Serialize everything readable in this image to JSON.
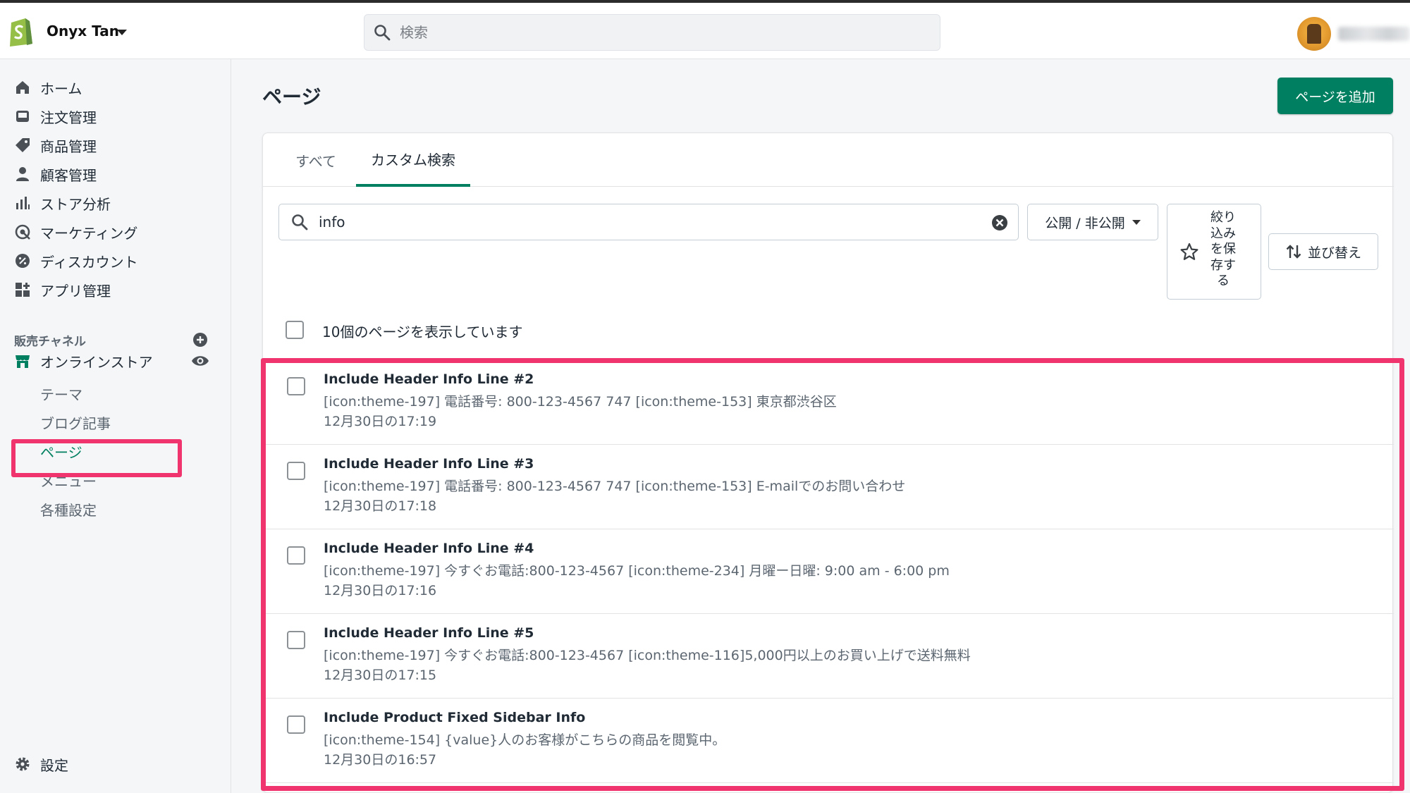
{
  "topbar": {
    "store_name": "Onyx Tan",
    "search_placeholder": "検索"
  },
  "sidebar": {
    "items": [
      {
        "label": "ホーム",
        "icon": "home-icon"
      },
      {
        "label": "注文管理",
        "icon": "inbox-icon"
      },
      {
        "label": "商品管理",
        "icon": "tag-icon"
      },
      {
        "label": "顧客管理",
        "icon": "person-icon"
      },
      {
        "label": "ストア分析",
        "icon": "bar-chart-icon"
      },
      {
        "label": "マーケティング",
        "icon": "target-icon"
      },
      {
        "label": "ディスカウント",
        "icon": "discount-icon"
      },
      {
        "label": "アプリ管理",
        "icon": "apps-icon"
      }
    ],
    "section_label": "販売チャネル",
    "online_store": "オンラインストア",
    "sub_items": [
      {
        "label": "テーマ",
        "active": false
      },
      {
        "label": "ブログ記事",
        "active": false
      },
      {
        "label": "ページ",
        "active": true
      },
      {
        "label": "メニュー",
        "active": false
      },
      {
        "label": "各種設定",
        "active": false
      }
    ],
    "settings": "設定"
  },
  "main": {
    "title": "ページ",
    "add_button": "ページを追加",
    "tabs": [
      {
        "label": "すべて",
        "active": false
      },
      {
        "label": "カスタム検索",
        "active": true
      }
    ],
    "search_value": "info",
    "filter_label": "公開 / 非公開",
    "save_filter_label": "絞り込みを保存する",
    "sort_label": "並び替え",
    "select_all_label": "10個のページを表示しています",
    "rows": [
      {
        "title": "Include Header Info Line #2",
        "desc": "[icon:theme-197] 電話番号: 800-123-4567 747 [icon:theme-153] 東京都渋谷区",
        "date": "12月30日の17:19"
      },
      {
        "title": "Include Header Info Line #3",
        "desc": "[icon:theme-197] 電話番号: 800-123-4567 747 [icon:theme-153] E-mailでのお問い合わせ",
        "date": "12月30日の17:18"
      },
      {
        "title": "Include Header Info Line #4",
        "desc": "[icon:theme-197] 今すぐお電話:800-123-4567 [icon:theme-234] 月曜ー日曜: 9:00 am - 6:00 pm",
        "date": "12月30日の17:16"
      },
      {
        "title": "Include Header Info Line #5",
        "desc": "[icon:theme-197] 今すぐお電話:800-123-4567 [icon:theme-116]5,000円以上のお買い上げで送料無料",
        "date": "12月30日の17:15"
      },
      {
        "title": "Include Product Fixed Sidebar Info",
        "desc": "[icon:theme-154] {value}人のお客様がこちらの商品を閲覧中。",
        "date": "12月30日の16:57"
      }
    ]
  },
  "colors": {
    "accent": "#008060",
    "highlight": "#f0346d"
  }
}
